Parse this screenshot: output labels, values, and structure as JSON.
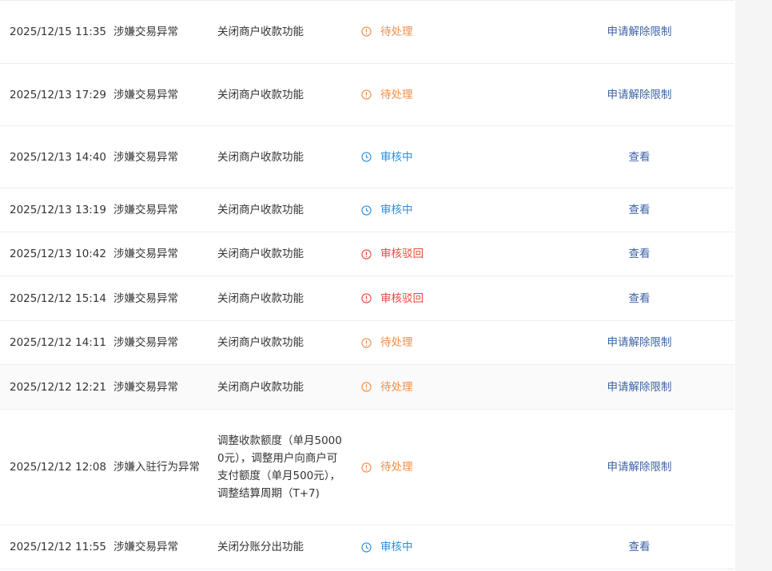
{
  "rows": [
    {
      "time": "2025/12/15 11:35",
      "reason": "涉嫌交易异常",
      "action": "关闭商户收款功能",
      "status": "待处理",
      "status_type": "pending",
      "operation": "申请解除限制"
    },
    {
      "time": "2025/12/13 17:29",
      "reason": "涉嫌交易异常",
      "action": "关闭商户收款功能",
      "status": "待处理",
      "status_type": "pending",
      "operation": "申请解除限制"
    },
    {
      "time": "2025/12/13 14:40",
      "reason": "涉嫌交易异常",
      "action": "关闭商户收款功能",
      "status": "审核中",
      "status_type": "review",
      "operation": "查看"
    },
    {
      "time": "2025/12/13 13:19",
      "reason": "涉嫌交易异常",
      "action": "关闭商户收款功能",
      "status": "审核中",
      "status_type": "review",
      "operation": "查看"
    },
    {
      "time": "2025/12/13 10:42",
      "reason": "涉嫌交易异常",
      "action": "关闭商户收款功能",
      "status": "审核驳回",
      "status_type": "rejected",
      "operation": "查看"
    },
    {
      "time": "2025/12/12 15:14",
      "reason": "涉嫌交易异常",
      "action": "关闭商户收款功能",
      "status": "审核驳回",
      "status_type": "rejected",
      "operation": "查看"
    },
    {
      "time": "2025/12/12 14:11",
      "reason": "涉嫌交易异常",
      "action": "关闭商户收款功能",
      "status": "待处理",
      "status_type": "pending",
      "operation": "申请解除限制"
    },
    {
      "time": "2025/12/12 12:21",
      "reason": "涉嫌交易异常",
      "action": "关闭商户收款功能",
      "status": "待处理",
      "status_type": "pending",
      "operation": "申请解除限制"
    },
    {
      "time": "2025/12/12 12:08",
      "reason": "涉嫌入驻行为异常",
      "action": "调整收款额度（单月50000元），调整用户向商户可支付额度（单月500元），调整结算周期（T+7)",
      "status": "待处理",
      "status_type": "pending",
      "operation": "申请解除限制"
    },
    {
      "time": "2025/12/12 11:55",
      "reason": "涉嫌交易异常",
      "action": "关闭分账分出功能",
      "status": "审核中",
      "status_type": "review",
      "operation": "查看"
    }
  ],
  "colors": {
    "pending": "#f08d49",
    "review": "#2b8ee0",
    "rejected": "#e84b3c",
    "link": "#3b63a8"
  },
  "icons": {
    "pending": "exclamation-circle-icon",
    "review": "clock-icon",
    "rejected": "exclamation-circle-icon"
  }
}
